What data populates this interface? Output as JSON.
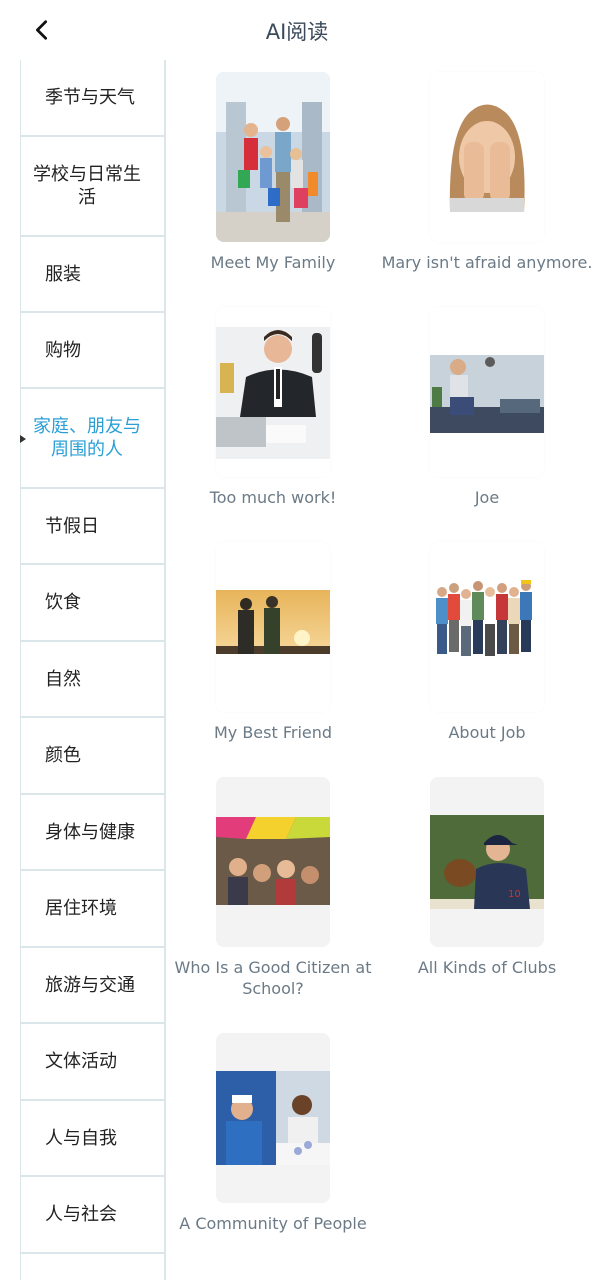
{
  "header": {
    "title": "AI阅读",
    "back_icon": "chevron-left-icon"
  },
  "sidebar": {
    "items": [
      {
        "label": "季节与天气"
      },
      {
        "label": "学校与日常生活"
      },
      {
        "label": "服装"
      },
      {
        "label": "购物"
      },
      {
        "label": "家庭、朋友与周围的人"
      },
      {
        "label": "节假日"
      },
      {
        "label": "饮食"
      },
      {
        "label": "自然"
      },
      {
        "label": "颜色"
      },
      {
        "label": "身体与健康"
      },
      {
        "label": "居住环境"
      },
      {
        "label": "旅游与交通"
      },
      {
        "label": "文体活动"
      },
      {
        "label": "人与自我"
      },
      {
        "label": "人与社会"
      }
    ],
    "active_index": 4,
    "active_color": "#2a9fd6"
  },
  "books": [
    {
      "title": "Meet My Family"
    },
    {
      "title": "Mary isn't afraid anymore."
    },
    {
      "title": "Too much work!"
    },
    {
      "title": "Joe"
    },
    {
      "title": "My Best Friend"
    },
    {
      "title": "About Job"
    },
    {
      "title": "Who Is a Good Citizen at School?"
    },
    {
      "title": "All Kinds of Clubs"
    },
    {
      "title": "A Community of People"
    }
  ]
}
